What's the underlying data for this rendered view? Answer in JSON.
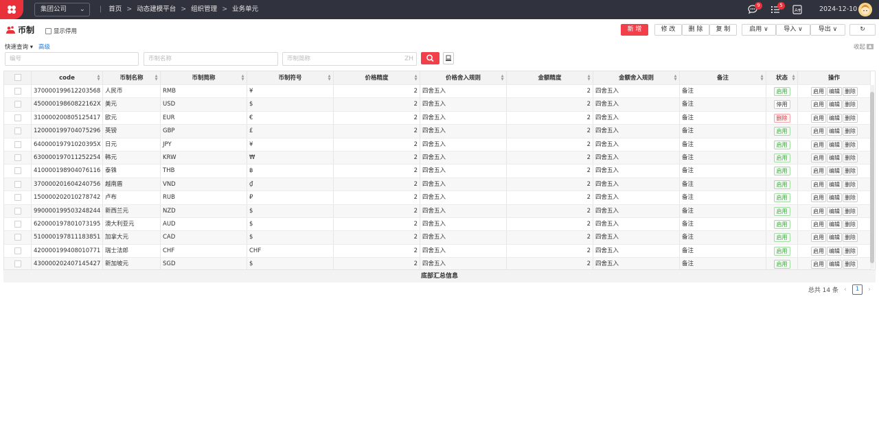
{
  "topbar": {
    "company": "集团公司",
    "breadcrumb": [
      "首页",
      "动态建模平台",
      "组织管理",
      "业务单元"
    ],
    "badge_chat": "9",
    "badge_tasks": "5",
    "date": "2024-12-10"
  },
  "page": {
    "title": "币制",
    "show_disabled": "显示停用",
    "quick_query": "快速查询",
    "advanced": "高级",
    "collapse": "收起"
  },
  "toolbar": {
    "new": "新 增",
    "edit": "修 改",
    "delete": "删 除",
    "copy": "复 制",
    "enable": "启用",
    "import": "导入",
    "export": "导出"
  },
  "search": {
    "code_placeholder": "编号",
    "name_placeholder": "币制名称",
    "abbr_placeholder": "币制简称",
    "zh": "ZH"
  },
  "table": {
    "headers": [
      "code",
      "币制名称",
      "币制简称",
      "币制符号",
      "价格精度",
      "价格舍入规则",
      "金额精度",
      "金额舍入规则",
      "备注",
      "状态",
      "操作"
    ],
    "rows": [
      {
        "code": "370000199612203568",
        "name": "人民币",
        "abbr": "RMB",
        "symbol": "¥",
        "pp": "2",
        "pr": "四舍五入",
        "ap": "2",
        "ar": "四舍五入",
        "note": "备注",
        "status": "启用",
        "st": "on"
      },
      {
        "code": "45000019860822162X",
        "name": "美元",
        "abbr": "USD",
        "symbol": "$",
        "pp": "2",
        "pr": "四舍五入",
        "ap": "2",
        "ar": "四舍五入",
        "note": "备注",
        "status": "停用",
        "st": "off"
      },
      {
        "code": "310000200805125417",
        "name": "欧元",
        "abbr": "EUR",
        "symbol": "€",
        "pp": "2",
        "pr": "四舍五入",
        "ap": "2",
        "ar": "四舍五入",
        "note": "备注",
        "status": "删除",
        "st": "del"
      },
      {
        "code": "120000199704075296",
        "name": "英镑",
        "abbr": "GBP",
        "symbol": "£",
        "pp": "2",
        "pr": "四舍五入",
        "ap": "2",
        "ar": "四舍五入",
        "note": "备注",
        "status": "启用",
        "st": "on"
      },
      {
        "code": "64000019791020395X",
        "name": "日元",
        "abbr": "JPY",
        "symbol": "¥",
        "pp": "2",
        "pr": "四舍五入",
        "ap": "2",
        "ar": "四舍五入",
        "note": "备注",
        "status": "启用",
        "st": "on"
      },
      {
        "code": "630000197011252254",
        "name": "韩元",
        "abbr": "KRW",
        "symbol": "₩",
        "pp": "2",
        "pr": "四舍五入",
        "ap": "2",
        "ar": "四舍五入",
        "note": "备注",
        "status": "启用",
        "st": "on"
      },
      {
        "code": "410000198904076116",
        "name": "泰铢",
        "abbr": "THB",
        "symbol": "฿",
        "pp": "2",
        "pr": "四舍五入",
        "ap": "2",
        "ar": "四舍五入",
        "note": "备注",
        "status": "启用",
        "st": "on"
      },
      {
        "code": "370000201604240756",
        "name": "越南盾",
        "abbr": "VND",
        "symbol": "₫",
        "pp": "2",
        "pr": "四舍五入",
        "ap": "2",
        "ar": "四舍五入",
        "note": "备注",
        "status": "启用",
        "st": "on"
      },
      {
        "code": "150000202010278742",
        "name": "卢布",
        "abbr": "RUB",
        "symbol": "₽",
        "pp": "2",
        "pr": "四舍五入",
        "ap": "2",
        "ar": "四舍五入",
        "note": "备注",
        "status": "启用",
        "st": "on"
      },
      {
        "code": "990000199503248244",
        "name": "新西兰元",
        "abbr": "NZD",
        "symbol": "$",
        "pp": "2",
        "pr": "四舍五入",
        "ap": "2",
        "ar": "四舍五入",
        "note": "备注",
        "status": "启用",
        "st": "on"
      },
      {
        "code": "620000197801073195",
        "name": "澳大利亚元",
        "abbr": "AUD",
        "symbol": "$",
        "pp": "2",
        "pr": "四舍五入",
        "ap": "2",
        "ar": "四舍五入",
        "note": "备注",
        "status": "启用",
        "st": "on"
      },
      {
        "code": "510000197811183851",
        "name": "加拿大元",
        "abbr": "CAD",
        "symbol": "$",
        "pp": "2",
        "pr": "四舍五入",
        "ap": "2",
        "ar": "四舍五入",
        "note": "备注",
        "status": "启用",
        "st": "on"
      },
      {
        "code": "420000199408010771",
        "name": "瑞士法郎",
        "abbr": "CHF",
        "symbol": "CHF",
        "pp": "2",
        "pr": "四舍五入",
        "ap": "2",
        "ar": "四舍五入",
        "note": "备注",
        "status": "启用",
        "st": "on"
      },
      {
        "code": "430000202407145427",
        "name": "新加坡元",
        "abbr": "SGD",
        "symbol": "$",
        "pp": "2",
        "pr": "四舍五入",
        "ap": "2",
        "ar": "四舍五入",
        "note": "备注",
        "status": "启用",
        "st": "on"
      }
    ],
    "ops": [
      "启用",
      "编辑",
      "删除"
    ]
  },
  "footer": {
    "summary": "底部汇总信息",
    "total": "总共 14 条",
    "page": "1"
  }
}
